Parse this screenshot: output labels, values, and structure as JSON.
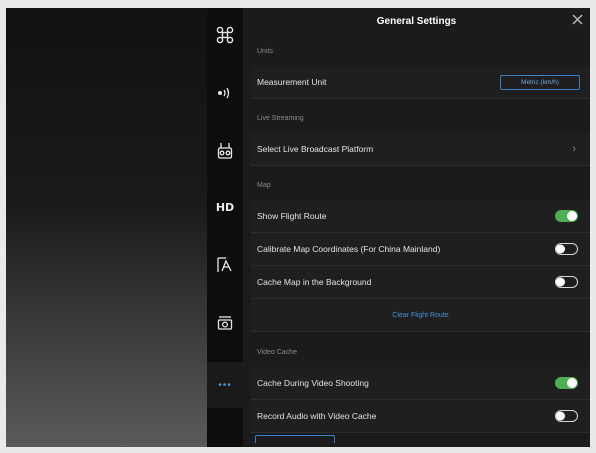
{
  "header": {
    "title": "General Settings",
    "close_icon": "close-icon"
  },
  "rail": [
    {
      "name": "aircraft-icon",
      "glyph": "⌘"
    },
    {
      "name": "remote-signal-icon",
      "glyph": "•))"
    },
    {
      "name": "controller-icon",
      "glyph": ""
    },
    {
      "name": "hd-icon",
      "glyph": "HD"
    },
    {
      "name": "battery-icon",
      "glyph": ""
    },
    {
      "name": "camera-icon",
      "glyph": ""
    },
    {
      "name": "more-icon",
      "glyph": "•••"
    }
  ],
  "sections": {
    "units": {
      "label": "Units",
      "measurement_label": "Measurement Unit",
      "measurement_value": "Metric (km/h)"
    },
    "live": {
      "label": "Live Streaming",
      "platform_label": "Select Live Broadcast Platform"
    },
    "map": {
      "label": "Map",
      "show_route_label": "Show Flight Route",
      "show_route_on": true,
      "calibrate_label": "Calibrate Map Coordinates (For China Mainland)",
      "calibrate_on": false,
      "cache_map_label": "Cache Map in the Background",
      "cache_map_on": false,
      "clear_route_label": "Clear Flight Route"
    },
    "video_cache": {
      "label": "Video Cache",
      "cache_during_label": "Cache During Video Shooting",
      "cache_during_on": true,
      "record_audio_label": "Record Audio with Video Cache",
      "record_audio_on": false
    }
  },
  "colors": {
    "accent": "#4a90d9",
    "toggle_on": "#4caf50",
    "panel_bg": "#1b1b1b"
  }
}
